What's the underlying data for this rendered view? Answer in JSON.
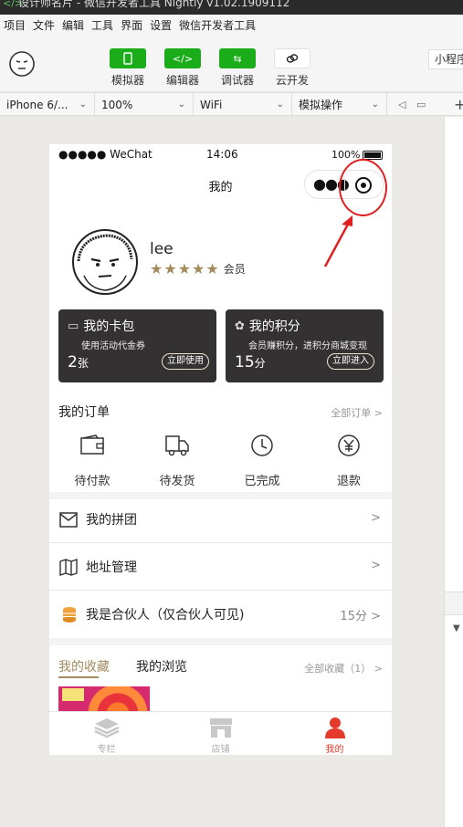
{
  "window": {
    "title": "设计师名片 - 微信开发者工具 Nightly v1.02.1909112"
  },
  "menu": [
    "项目",
    "文件",
    "编辑",
    "工具",
    "界面",
    "设置",
    "微信开发者工具"
  ],
  "toolbar": {
    "simulator": "模拟器",
    "editor": "编辑器",
    "debugger": "调试器",
    "cloud": "云开发",
    "miniprogram": "小程序",
    "editor_glyph": "</>",
    "debugger_glyph": "⇆"
  },
  "devicebar": {
    "device": "iPhone 6/...",
    "zoom": "100%",
    "network": "WiFi",
    "sim_ops": "模拟操作"
  },
  "phone": {
    "status": {
      "carrier": "●●●●● WeChat",
      "time": "14:06",
      "battery": "100%"
    },
    "nav_title": "我的",
    "user": {
      "name": "lee",
      "stars": "★★★★★",
      "level": "会员"
    },
    "cards": [
      {
        "title": "我的卡包",
        "sub": "使用活动代金券",
        "num": "2",
        "unit": "张",
        "btn": "立即使用"
      },
      {
        "title": "我的积分",
        "sub": "会员赚积分，进积分商城变现",
        "num": "15",
        "unit": "分",
        "btn": "立即进入"
      }
    ],
    "orders": {
      "title": "我的订单",
      "more": "全部订单 >",
      "items": [
        "待付款",
        "待发货",
        "已完成",
        "退款"
      ]
    },
    "rows": [
      {
        "label": "我的拼团",
        "right": ">"
      },
      {
        "label": "地址管理",
        "right": ">"
      },
      {
        "label": "我是合伙人（仅合伙人可见)",
        "right": "15分 >"
      }
    ],
    "favorites": {
      "tab_active": "我的收藏",
      "tab_other": "我的浏览",
      "more": "全部收藏（1） >"
    },
    "tabbar": [
      "专栏",
      "店铺",
      "我的"
    ]
  },
  "colors": {
    "accent_gold": "#a38b5e",
    "card_dark": "#333131",
    "annotation_red": "#e02020",
    "tab_active": "#e33a2c",
    "toolbar_green": "#1aad19"
  }
}
